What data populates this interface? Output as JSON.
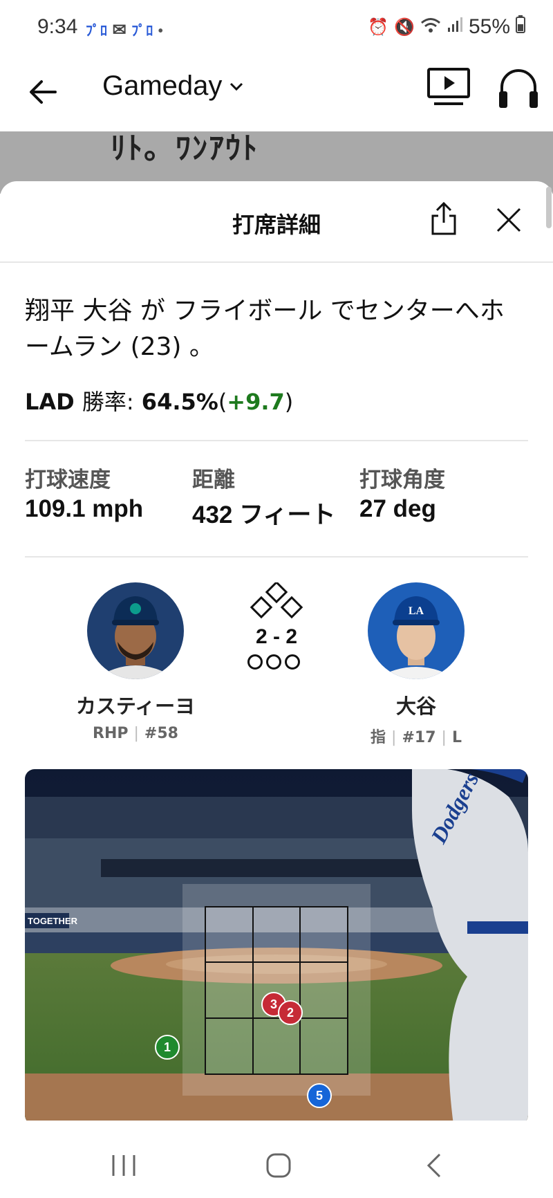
{
  "status_bar": {
    "time": "9:34",
    "notif_left": "ﾌﾟﾛ",
    "notif_right": "ﾌﾟﾛ",
    "battery": "55%"
  },
  "app_bar": {
    "title": "Gameday"
  },
  "background": {
    "peek_text": "ﾘﾄ。ﾜﾝｱｳﾄ"
  },
  "sheet": {
    "title": "打席詳細",
    "play_description": "翔平 大谷 が フライボール でセンターへホームラン (23) 。",
    "win_prob": {
      "team": "LAD",
      "label": "勝率:",
      "value": "64.5%",
      "open": "(",
      "delta": "+9.7",
      "close": ")"
    },
    "stats": [
      {
        "label": "打球速度",
        "value": "109.1 mph"
      },
      {
        "label": "距離",
        "value": "432 フィート"
      },
      {
        "label": "打球角度",
        "value": "27 deg"
      }
    ],
    "pitcher": {
      "name": "カスティーヨ",
      "hand": "RHP",
      "number": "#58"
    },
    "batter": {
      "name": "大谷",
      "position": "指",
      "number": "#17",
      "bats": "L"
    },
    "count": "2 - 2",
    "outs": 0,
    "ad_text": "TOGETHER",
    "jersey_text": "Dodgers",
    "pitches": [
      {
        "num": "1",
        "color": "#1f8a2e"
      },
      {
        "num": "2",
        "color": "#c62a36"
      },
      {
        "num": "3",
        "color": "#c62a36"
      },
      {
        "num": "5",
        "color": "#1565d8"
      }
    ]
  },
  "colors": {
    "ball_marker": "#1f8a2e",
    "strike_marker": "#c62a36",
    "in_play_marker": "#1565d8",
    "win_delta": "#1e7a1e"
  }
}
